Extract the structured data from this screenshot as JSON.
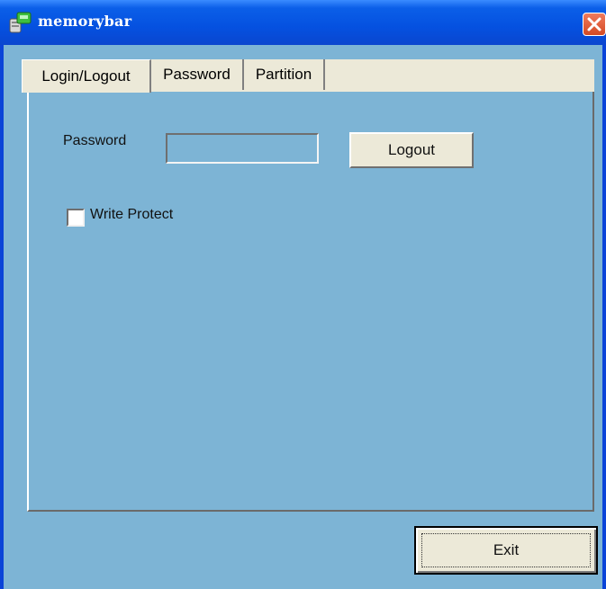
{
  "window": {
    "title": "memorybar",
    "icon": "app-drive-icon",
    "close_icon": "close-icon"
  },
  "tabs": [
    {
      "label": "Login/Logout",
      "active": true
    },
    {
      "label": "Password",
      "active": false
    },
    {
      "label": "Partition",
      "active": false
    }
  ],
  "login_panel": {
    "password_label": "Password",
    "password_value": "",
    "logout_label": "Logout",
    "write_protect_label": "Write Protect",
    "write_protect_checked": false
  },
  "footer": {
    "exit_label": "Exit"
  },
  "colors": {
    "titlebar": "#0551e0",
    "client_background": "#7db4d5",
    "tab_face": "#ece9d8",
    "close_button": "#d44a24"
  }
}
